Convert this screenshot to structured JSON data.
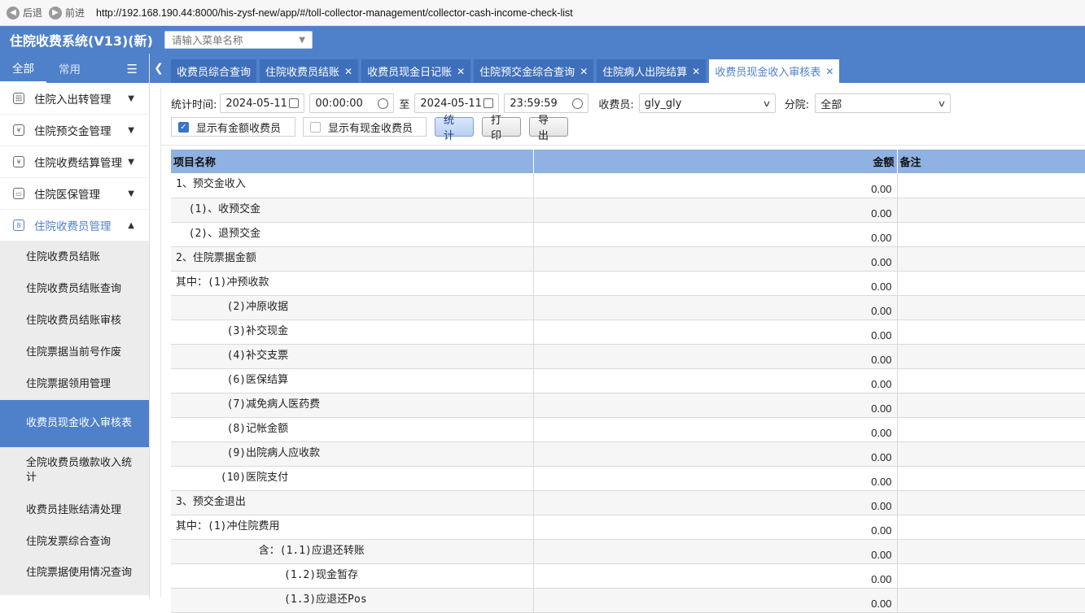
{
  "browser": {
    "back_label": "后退",
    "forward_label": "前进",
    "url": "http://192.168.190.44:8000/his-zysf-new/app/#/toll-collector-management/collector-cash-income-check-list"
  },
  "app": {
    "title": "住院收费系统(V13)(新)",
    "menu_search_placeholder": "请输入菜单名称"
  },
  "sidebar": {
    "tabs": [
      "全部",
      "常用"
    ],
    "menu": [
      {
        "label": "住院入出转管理",
        "icon": "building-icon",
        "open": false
      },
      {
        "label": "住院预交金管理",
        "icon": "coin-icon",
        "open": false
      },
      {
        "label": "住院收费结算管理",
        "icon": "receipt-icon",
        "open": false
      },
      {
        "label": "住院医保管理",
        "icon": "card-icon",
        "open": false
      },
      {
        "label": "住院收费员管理",
        "icon": "users-icon",
        "open": true
      }
    ],
    "submenu": [
      "住院收费员结账",
      "住院收费员结账查询",
      "住院收费员结账审核",
      "住院票据当前号作废",
      "住院票据领用管理",
      "收费员现金收入审核表",
      "全院收费员缴款收入统计",
      "收费员挂账结清处理",
      "住院发票综合查询",
      "住院票据使用情况查询"
    ]
  },
  "tabs": [
    {
      "label": "收费员综合查询",
      "closable": false
    },
    {
      "label": "住院收费员结账",
      "closable": true
    },
    {
      "label": "收费员现金日记账",
      "closable": true
    },
    {
      "label": "住院预交金综合查询",
      "closable": true
    },
    {
      "label": "住院病人出院结算",
      "closable": true
    },
    {
      "label": "收费员现金收入审核表",
      "closable": true
    }
  ],
  "filters": {
    "stat_time_label": "统计时间:",
    "start_date": "2024-05-11",
    "start_time": "00:00:00",
    "to_label": "至",
    "end_date": "2024-05-11",
    "end_time": "23:59:59",
    "collector_label": "收费员:",
    "collector_value": "gly_gly",
    "branch_label": "分院:",
    "branch_value": "全部",
    "show_amount_label": "显示有金额收费员",
    "show_amount_checked": true,
    "show_cash_label": "显示有现金收费员",
    "show_cash_checked": false,
    "stat_button": "统 计",
    "print_button": "打 印",
    "export_button": "导 出"
  },
  "table": {
    "headers": [
      "项目名称",
      "金额",
      "备注"
    ],
    "rows": [
      {
        "name": "1、预交金收入",
        "amount": "0.00",
        "remark": ""
      },
      {
        "name": "  (1)、收预交金",
        "amount": "0.00",
        "remark": ""
      },
      {
        "name": "  (2)、退预交金",
        "amount": "0.00",
        "remark": ""
      },
      {
        "name": "2、住院票据金额",
        "amount": "0.00",
        "remark": ""
      },
      {
        "name": "其中：(1)冲预收款",
        "amount": "0.00",
        "remark": ""
      },
      {
        "name": "        (2)冲原收据",
        "amount": "0.00",
        "remark": ""
      },
      {
        "name": "        (3)补交现金",
        "amount": "0.00",
        "remark": ""
      },
      {
        "name": "        (4)补交支票",
        "amount": "0.00",
        "remark": ""
      },
      {
        "name": "        (6)医保结算",
        "amount": "0.00",
        "remark": ""
      },
      {
        "name": "        (7)减免病人医药费",
        "amount": "0.00",
        "remark": ""
      },
      {
        "name": "        (8)记帐金额",
        "amount": "0.00",
        "remark": ""
      },
      {
        "name": "        (9)出院病人应收款",
        "amount": "0.00",
        "remark": ""
      },
      {
        "name": "       (10)医院支付",
        "amount": "0.00",
        "remark": ""
      },
      {
        "name": "3、预交金退出",
        "amount": "0.00",
        "remark": ""
      },
      {
        "name": "其中：(1)冲住院费用",
        "amount": "0.00",
        "remark": ""
      },
      {
        "name": "             含：(1.1)应退还转账",
        "amount": "0.00",
        "remark": ""
      },
      {
        "name": "                 (1.2)现金暂存",
        "amount": "0.00",
        "remark": ""
      },
      {
        "name": "                 (1.3)应退还Pos",
        "amount": "0.00",
        "remark": ""
      }
    ]
  }
}
